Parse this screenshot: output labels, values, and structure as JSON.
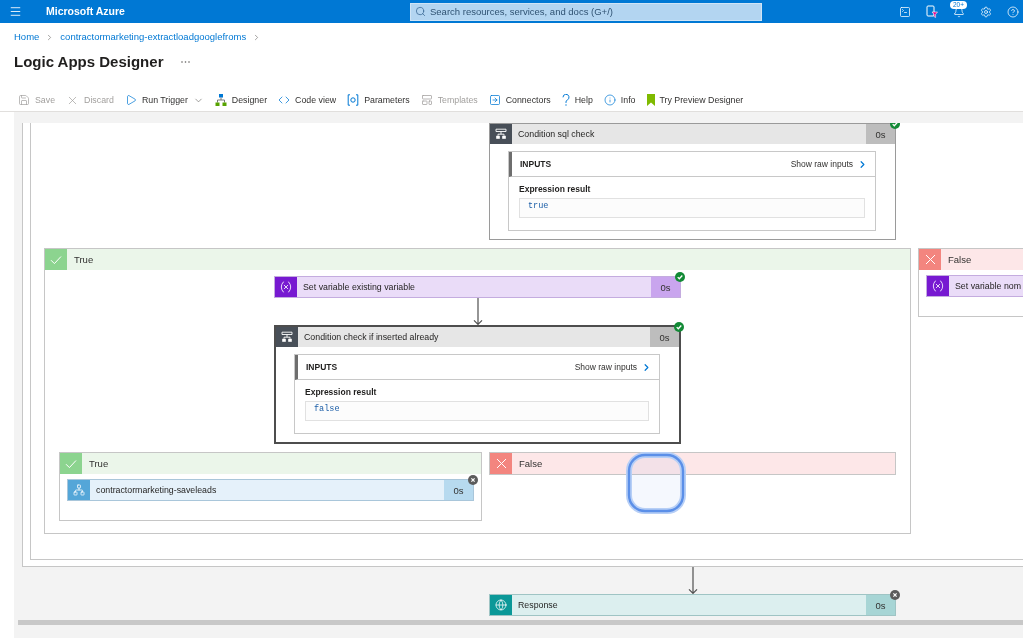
{
  "top_bar": {
    "brand": "Microsoft Azure",
    "search": {
      "placeholder": "Search resources, services, and docs (G+/)"
    },
    "notification_count": "20+"
  },
  "breadcrumb": [
    {
      "label": "Home"
    },
    {
      "label": "contractormarketing-extractloadgooglefroms"
    }
  ],
  "page_title": "Logic Apps Designer",
  "toolbar": [
    {
      "kind": "save",
      "label": "Save",
      "disabled": true,
      "dropdown": false
    },
    {
      "kind": "discard",
      "label": "Discard",
      "disabled": true,
      "dropdown": false
    },
    {
      "kind": "run",
      "label": "Run Trigger",
      "disabled": false,
      "dropdown": true
    },
    {
      "kind": "designer",
      "label": "Designer",
      "disabled": false,
      "dropdown": false
    },
    {
      "kind": "code",
      "label": "Code view",
      "disabled": false,
      "dropdown": false
    },
    {
      "kind": "parameters",
      "label": "Parameters",
      "disabled": false,
      "dropdown": false
    },
    {
      "kind": "templates",
      "label": "Templates",
      "disabled": true,
      "dropdown": false
    },
    {
      "kind": "connectors",
      "label": "Connectors",
      "disabled": false,
      "dropdown": false
    },
    {
      "kind": "help",
      "label": "Help",
      "disabled": false,
      "dropdown": false
    },
    {
      "kind": "info",
      "label": "Info",
      "disabled": false,
      "dropdown": false
    },
    {
      "kind": "preview",
      "label": "Try Preview Designer",
      "disabled": false,
      "dropdown": false
    }
  ],
  "designer": {
    "actions": [
      {
        "kind": "scope",
        "actions": [
          {
            "kind": "scope",
            "actions": [
              {
                "kind": "condition",
                "title": "Condition sql check",
                "duration": "0s",
                "succeeded": true,
                "selected": false,
                "inputs": {
                  "heading": "INPUTS",
                  "link": "Show raw inputs",
                  "label": "Expression result",
                  "value": "true"
                },
                "branches": [
                  {
                    "kind": "true",
                    "label": "True",
                    "actions": [
                      {
                        "kind": "variable",
                        "title": "Set variable existing variable",
                        "duration": "0s",
                        "succeeded": true,
                        "selected": false
                      },
                      {
                        "kind": "condition",
                        "title": "Condition check if inserted already",
                        "duration": "0s",
                        "succeeded": true,
                        "selected": true,
                        "inputs": {
                          "heading": "INPUTS",
                          "link": "Show raw inputs",
                          "label": "Expression result",
                          "value": "false"
                        },
                        "branches": [
                          {
                            "kind": "true",
                            "label": "True",
                            "actions": [
                              {
                                "kind": "workflow",
                                "title": "contractormarketing-saveleads",
                                "duration": "0s",
                                "succeeded": false,
                                "selected": false
                              }
                            ]
                          },
                          {
                            "kind": "false",
                            "label": "False"
                          }
                        ]
                      }
                    ]
                  },
                  {
                    "kind": "false",
                    "label": "False",
                    "actions": [
                      {
                        "kind": "variable",
                        "title": "Set variable nom",
                        "selected": false
                      }
                    ]
                  }
                ]
              }
            ]
          }
        ]
      },
      {
        "kind": "response",
        "title": "Response",
        "duration": "0s",
        "succeeded": false,
        "selected": false
      }
    ]
  }
}
